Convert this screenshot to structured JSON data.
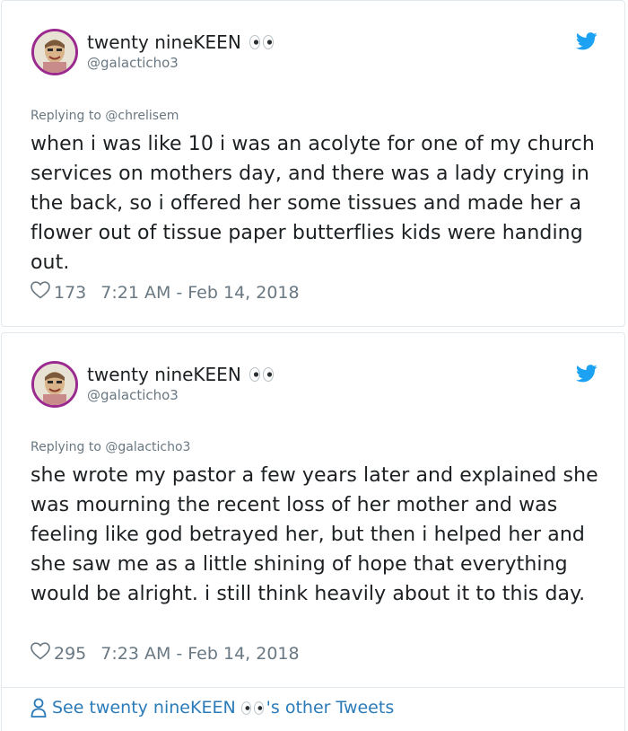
{
  "tweets": [
    {
      "display_name": "twenty nineKEEN",
      "handle": "@galacticho3",
      "replying_label": "Replying to",
      "replying_to": "@chrelisem",
      "text": "when i was like 10 i was an acolyte for one of my church services on mothers day, and there was a lady crying in the back, so i offered her some tissues and made her a flower out of tissue paper butterflies kids were handing out.",
      "likes": "173",
      "timestamp": "7:21 AM - Feb 14, 2018"
    },
    {
      "display_name": "twenty nineKEEN",
      "handle": "@galacticho3",
      "replying_label": "Replying to",
      "replying_to": "@galacticho3",
      "text": "she wrote my pastor a few years later and explained she was mourning the recent loss of her mother and was feeling like god betrayed her, but then i helped her and she saw me as a little shining of hope that everything would be alright. i still think heavily about it to this day.",
      "likes": "295",
      "timestamp": "7:23 AM - Feb 14, 2018"
    }
  ],
  "footer": {
    "prefix": "See twenty nineKEEN",
    "suffix": "'s other Tweets"
  },
  "icons": {
    "eyes": "eyes-emoji-icon",
    "bird": "twitter-bird-icon",
    "heart": "heart-icon",
    "person": "person-icon"
  },
  "colors": {
    "twitter_blue": "#1da1f2",
    "link_blue": "#2b7bb9",
    "secondary_text": "#697882",
    "border": "#e1e8ed"
  }
}
